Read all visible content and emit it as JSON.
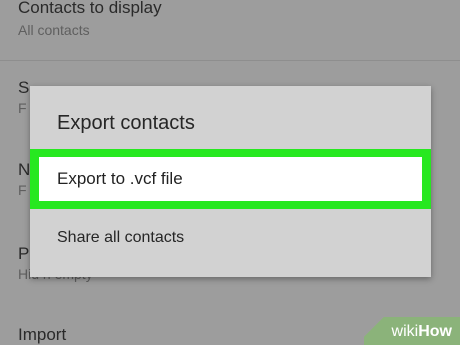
{
  "background": {
    "items": [
      {
        "title": "Contacts to display",
        "subtitle": "All contacts"
      },
      {
        "title": "S",
        "subtitle": "F"
      },
      {
        "title": "N",
        "subtitle": "F"
      },
      {
        "title": "P",
        "subtitle": "Hid n empty"
      },
      {
        "title": "Import",
        "subtitle": ""
      }
    ]
  },
  "dialog": {
    "title": "Export contacts",
    "options": [
      {
        "label": "Export to .vcf file"
      },
      {
        "label": "Share all contacts"
      }
    ]
  },
  "watermark": {
    "part1": "wiki",
    "part2": "How"
  },
  "colors": {
    "highlight": "#27e820",
    "dialog_bg": "#d2d2d2",
    "overlay_bg": "#9d9d9d"
  }
}
